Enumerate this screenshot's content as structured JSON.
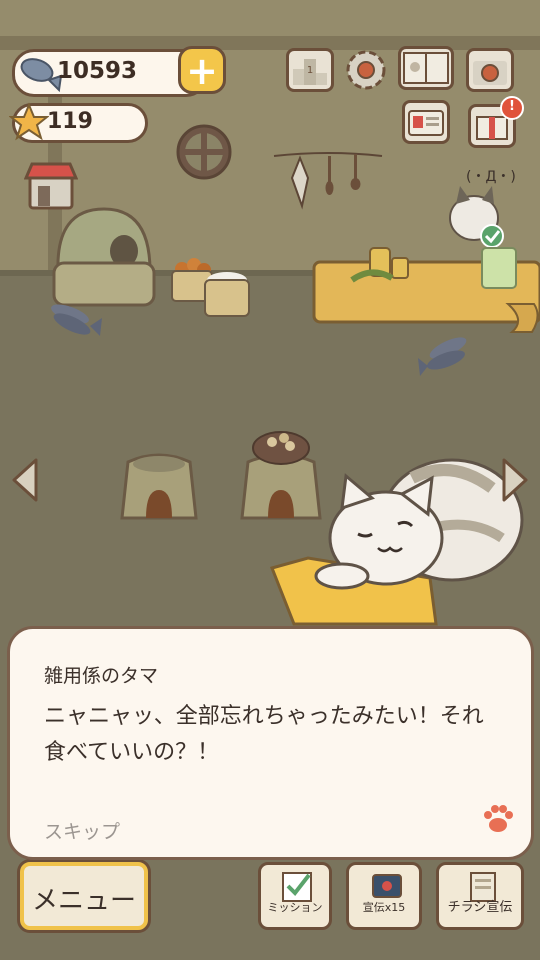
{
  "currency": {
    "fish_count": "10593",
    "star_count": "119",
    "add_label": "+"
  },
  "toolbar": {
    "ranking_icon": "ranking-icon",
    "settings_icon": "gear-icon",
    "catbook_icon": "book-icon",
    "camera_icon": "camera-icon",
    "staff_icon": "id-card-icon",
    "gift_icon": "gift-icon",
    "gift_badge": "!"
  },
  "speech_bubble": {
    "text": "(・Д・)"
  },
  "dialog": {
    "speaker": "雑用係のタマ",
    "message": "ニャニャッ、全部忘れちゃったみたい！それ食べていいの？！",
    "skip_label": "スキップ"
  },
  "bottom_bar": {
    "menu_label": "メニュー",
    "mission_label": "ミッション",
    "ad_label": "宣伝x15",
    "flyer_label": "チラシ宣伝"
  },
  "colors": {
    "accent": "#f3c64a",
    "outline": "#6b4f3a",
    "panel": "#fdf7ef",
    "wall": "#958c6c",
    "floor": "#7a745d"
  }
}
